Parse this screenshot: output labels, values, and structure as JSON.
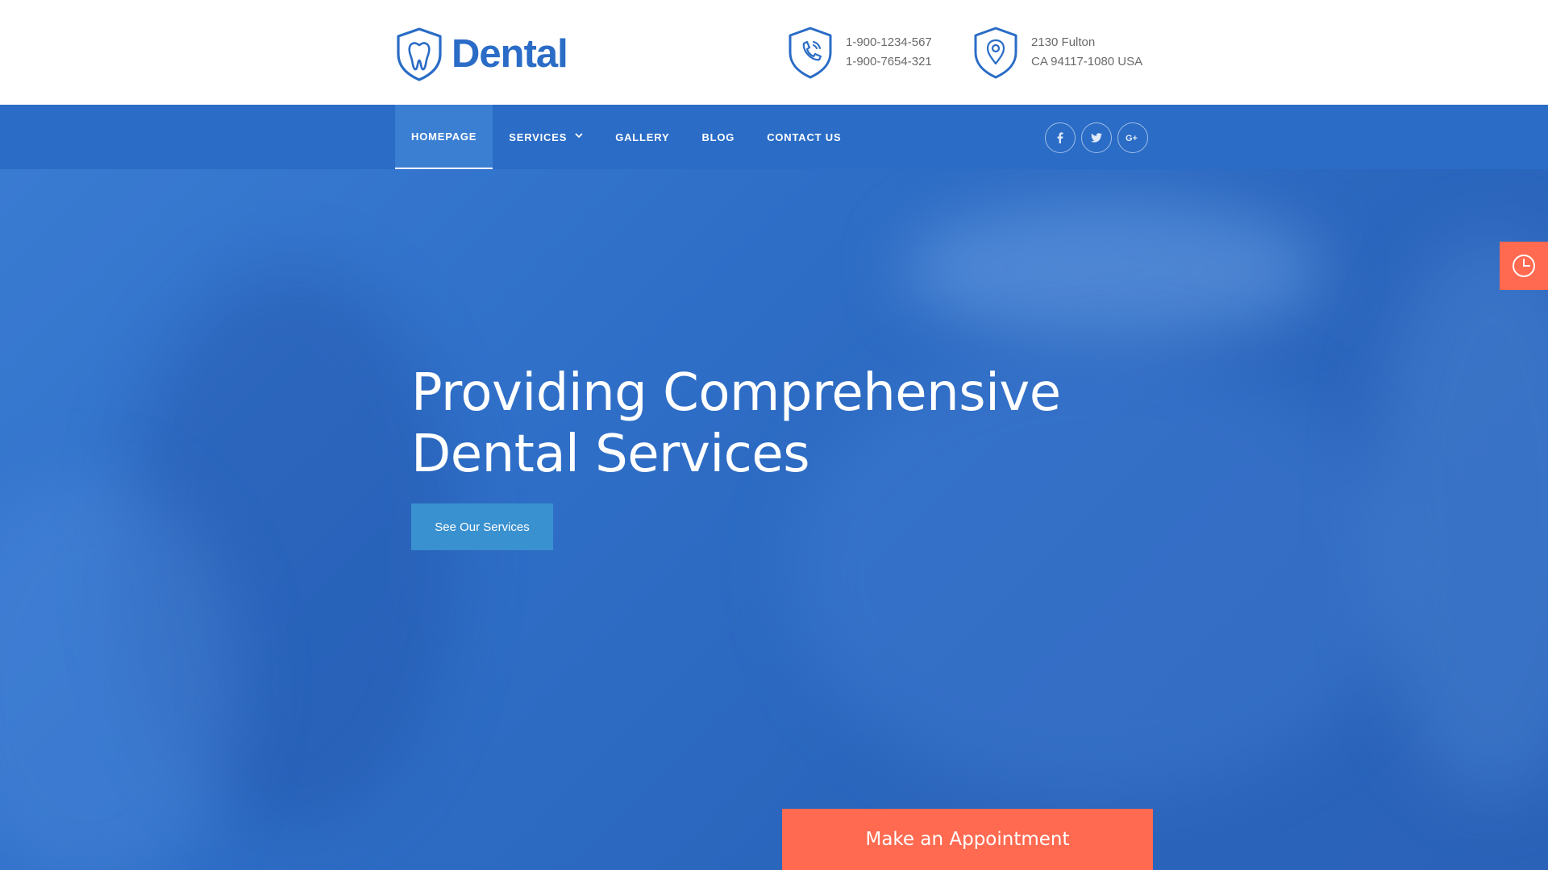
{
  "brand": {
    "name": "Dental",
    "logo_icon": "tooth-shield-icon"
  },
  "contacts": {
    "phone": {
      "icon": "phone-shield-icon",
      "lines": [
        "1-900-1234-567",
        "1-900-7654-321"
      ]
    },
    "address": {
      "icon": "location-shield-icon",
      "lines": [
        "2130 Fulton",
        "CA 94117-1080 USA"
      ]
    }
  },
  "nav": {
    "items": [
      {
        "label": "HOMEPAGE",
        "active": true
      },
      {
        "label": "SERVICES",
        "has_dropdown": true
      },
      {
        "label": "GALLERY"
      },
      {
        "label": "BLOG"
      },
      {
        "label": "CONTACT US"
      }
    ],
    "socials": [
      {
        "name": "facebook-icon",
        "glyph": "f"
      },
      {
        "name": "twitter-icon",
        "glyph": "t"
      },
      {
        "name": "google-plus-icon",
        "glyph": "G+"
      }
    ]
  },
  "hero": {
    "title_line1": "Providing Comprehensive",
    "title_line2": "Dental Services",
    "cta_label": "See Our Services"
  },
  "appointment": {
    "label": "Make an Appointment"
  },
  "side_tab": {
    "icon": "clock-icon"
  },
  "colors": {
    "primary": "#2a6cc6",
    "accent": "#ff6a51",
    "button": "#3a91d0"
  }
}
